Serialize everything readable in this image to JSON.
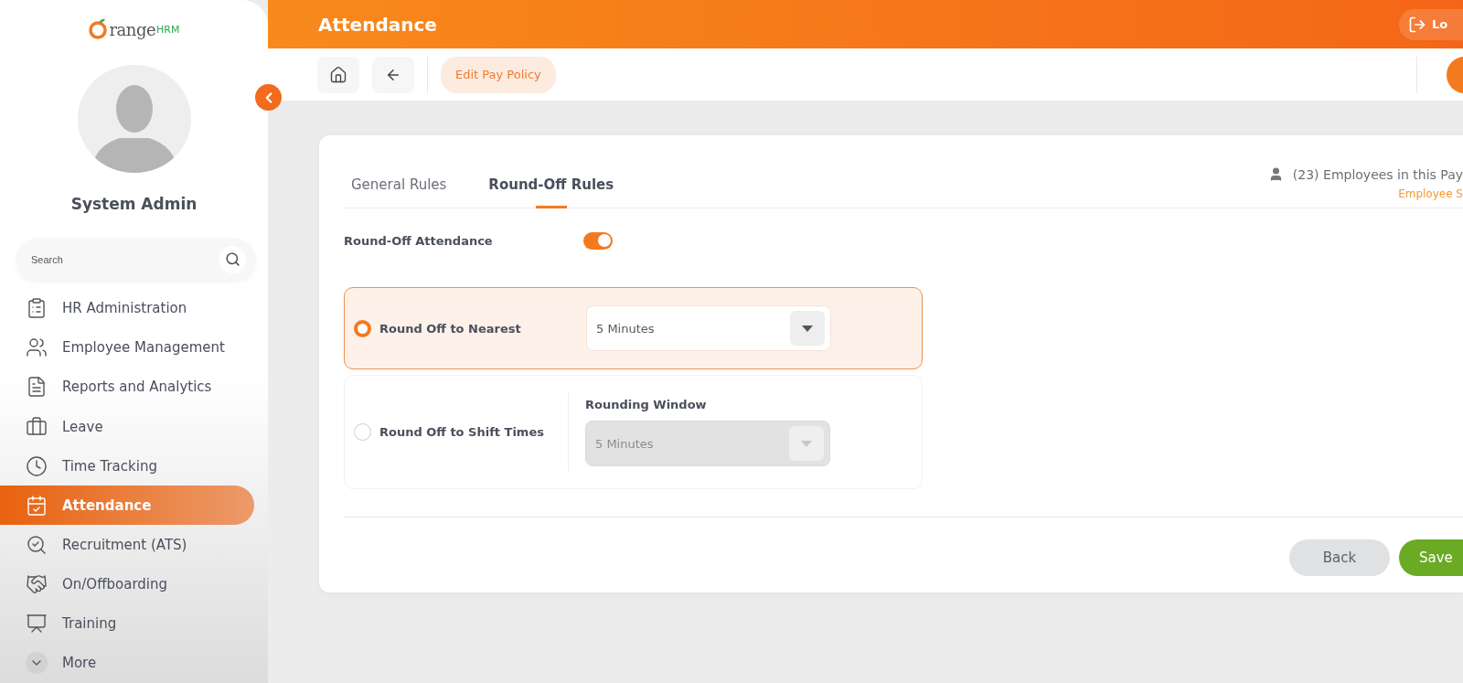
{
  "logo": {
    "name": "range",
    "suffix": "HRM"
  },
  "user": {
    "name": "System Admin"
  },
  "sidebar": {
    "search": {
      "placeholder": "Search"
    },
    "items": [
      {
        "label": "HR Administration",
        "selected": false
      },
      {
        "label": "Employee Management",
        "selected": false
      },
      {
        "label": "Reports and Analytics",
        "selected": false
      },
      {
        "label": "Leave",
        "selected": false
      },
      {
        "label": "Time Tracking",
        "selected": false
      },
      {
        "label": "Attendance",
        "selected": true
      },
      {
        "label": "Recruitment (ATS)",
        "selected": false
      },
      {
        "label": "On/Offboarding",
        "selected": false
      },
      {
        "label": "Training",
        "selected": false
      },
      {
        "label": "More",
        "selected": false
      }
    ]
  },
  "header": {
    "title": "Attendance",
    "logout": "Lo"
  },
  "toolbar": {
    "breadcrumb": "Edit Pay Policy"
  },
  "tabs": [
    {
      "label": "General Rules",
      "selected": false
    },
    {
      "label": "Round-Off Rules",
      "selected": true
    }
  ],
  "employees": {
    "count_text": "(23) Employees in this Pay",
    "link": "Employee S"
  },
  "round_off_attendance": {
    "label": "Round-Off Attendance",
    "on": true
  },
  "options": [
    {
      "label": "Round Off to Nearest",
      "selected": true,
      "dropdown": {
        "value": "5 Minutes",
        "disabled": false
      }
    },
    {
      "label": "Round Off to Shift Times",
      "selected": false,
      "dropdown": {
        "label": "Rounding Window",
        "value": "5 Minutes",
        "disabled": true
      }
    }
  ],
  "buttons": {
    "back": "Back",
    "save": "Save"
  }
}
